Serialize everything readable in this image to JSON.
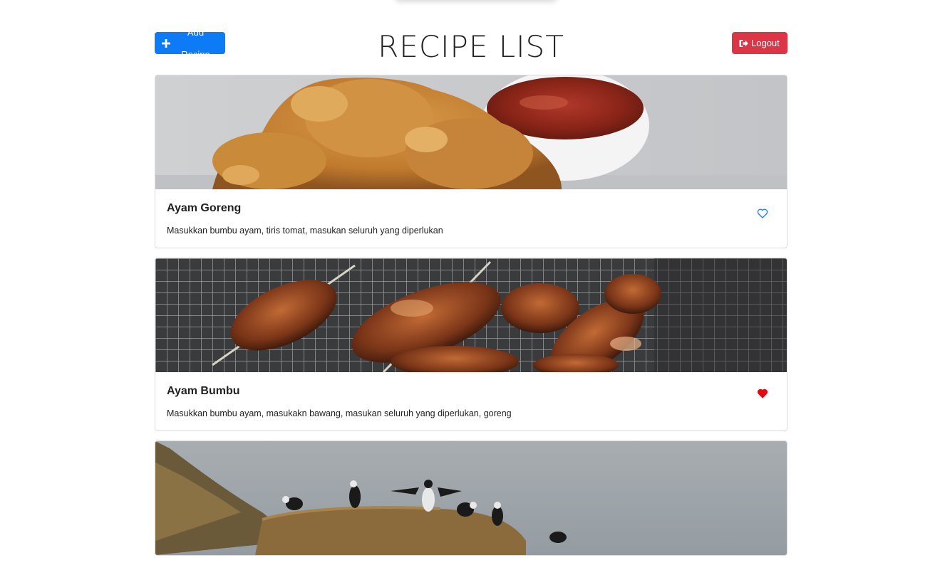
{
  "header": {
    "title": "RECIPE LIST",
    "add_button_label": "Add Recipe",
    "logout_button_label": "Logout"
  },
  "recipes": [
    {
      "name": "Ayam Goreng",
      "description": "Masukkan bumbu ayam, tiris tomat, masukan seluruh yang diperlukan",
      "favorite": false,
      "image": "fried-chicken-with-sauce"
    },
    {
      "name": "Ayam Bumbu",
      "description": "Masukkan bumbu ayam, masukakn bawang, masukan seluruh yang diperlukan, goreng",
      "favorite": true,
      "image": "grilled-chicken-wings"
    },
    {
      "name": "",
      "description": "",
      "favorite": false,
      "image": "puffins-on-cliff"
    }
  ],
  "colors": {
    "primary": "#0d7bf5",
    "danger": "#dc3545",
    "favorite_active": "#e8070f",
    "favorite_inactive": "#2a7ef0"
  },
  "icons": {
    "add": "plus-icon",
    "logout": "sign-out-icon",
    "favorite_outline": "heart-outline-icon",
    "favorite_filled": "heart-filled-icon"
  }
}
